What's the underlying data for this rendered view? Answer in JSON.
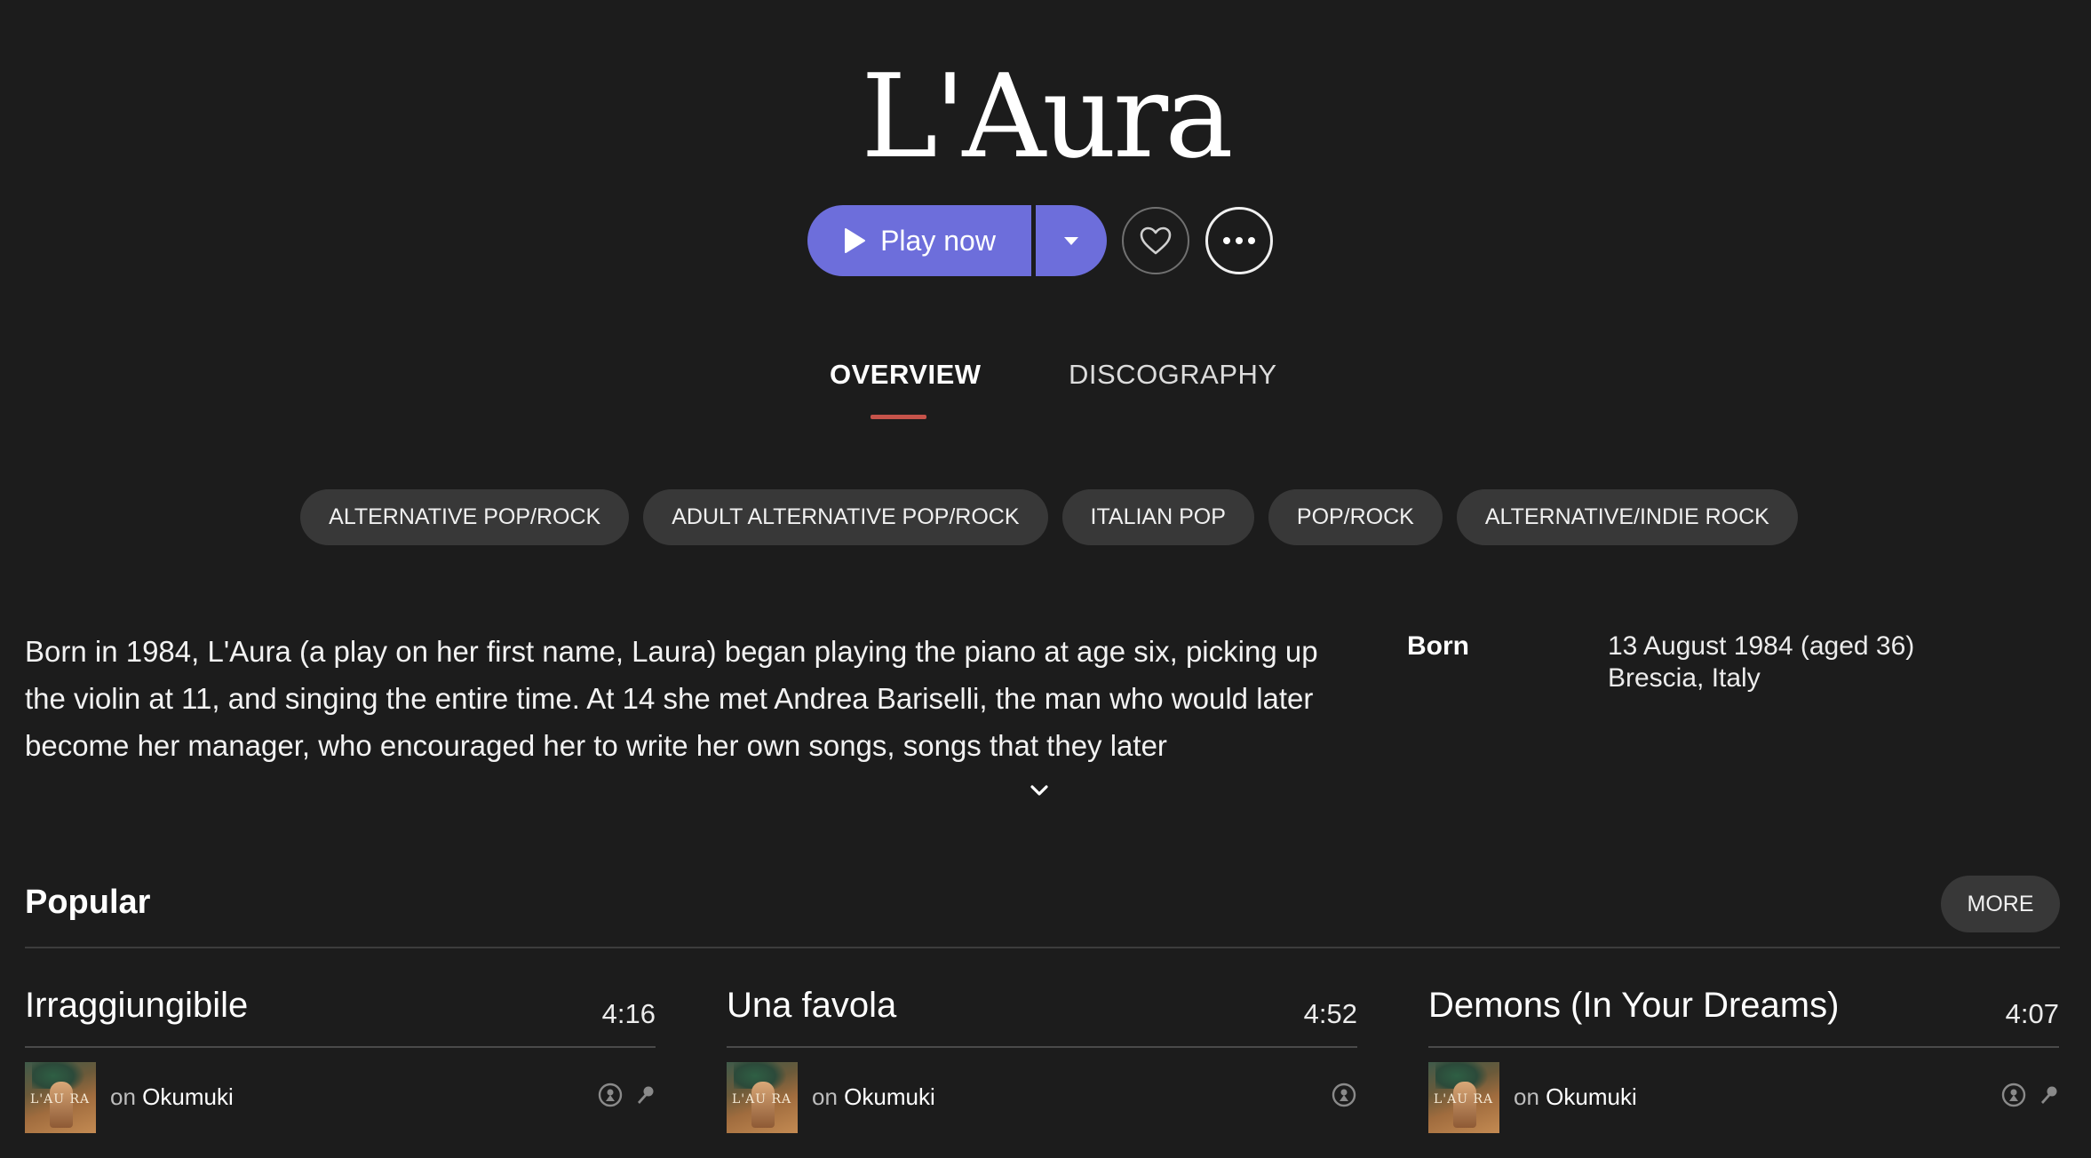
{
  "artist": {
    "name": "L'Aura"
  },
  "actions": {
    "play_label": "Play now",
    "play_icon": "play-icon",
    "dropdown_icon": "caret-down-icon",
    "favorite_icon": "heart-icon",
    "more_icon": "ellipsis-icon"
  },
  "tabs": [
    {
      "label": "OVERVIEW",
      "active": true
    },
    {
      "label": "DISCOGRAPHY",
      "active": false
    }
  ],
  "genres": [
    "ALTERNATIVE POP/ROCK",
    "ADULT ALTERNATIVE POP/ROCK",
    "ITALIAN POP",
    "POP/ROCK",
    "ALTERNATIVE/INDIE ROCK"
  ],
  "bio": {
    "text": "Born in 1984, L'Aura (a play on her first name, Laura) began playing the piano at age six, picking up the violin at 11, and singing the entire time. At 14 she met Andrea Bariselli, the man who would later become her manager, who encouraged her to write her own songs, songs that they later",
    "expand_icon": "chevron-down-icon"
  },
  "info": {
    "born_label": "Born",
    "born_date": "13 August 1984 (aged 36)",
    "born_place": "Brescia, Italy"
  },
  "popular": {
    "title": "Popular",
    "more_label": "MORE",
    "tracks": [
      {
        "title": "Irraggiungibile",
        "duration": "4:16",
        "on": "on",
        "album": "Okumuki",
        "art_text": "L'AU RA"
      },
      {
        "title": "Una favola",
        "duration": "4:52",
        "on": "on",
        "album": "Okumuki",
        "art_text": "L'AU RA"
      },
      {
        "title": "Demons (In Your Dreams)",
        "duration": "4:07",
        "on": "on",
        "album": "Okumuki",
        "art_text": "L'AU RA"
      }
    ]
  },
  "colors": {
    "background": "#1c1c1c",
    "accent": "#6d6edb",
    "tab_indicator": "#c6534a",
    "pill": "#383838"
  }
}
